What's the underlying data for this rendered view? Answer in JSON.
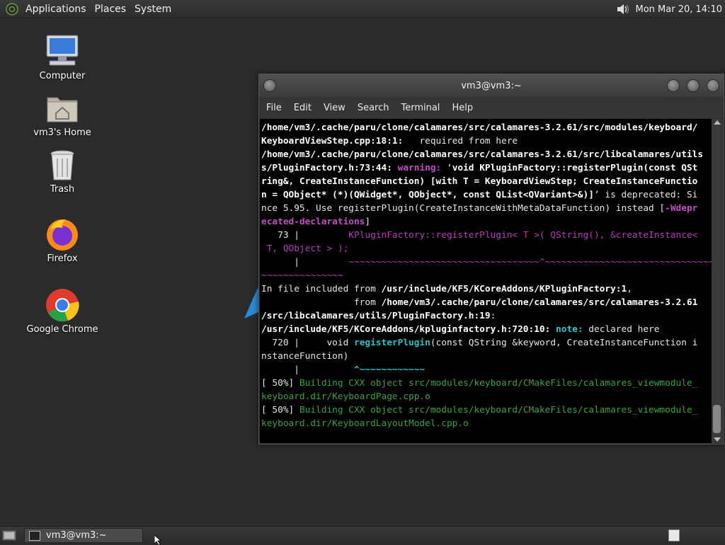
{
  "top_panel": {
    "menus": [
      "Applications",
      "Places",
      "System"
    ],
    "clock": "Mon Mar 20, 14:10"
  },
  "desktop_icons": [
    "Computer",
    "vm3's Home",
    "Trash",
    "Firefox",
    "Google Chrome"
  ],
  "window": {
    "title": "vm3@vm3:~",
    "menus": [
      "File",
      "Edit",
      "View",
      "Search",
      "Terminal",
      "Help"
    ]
  },
  "terminal": {
    "lines": [
      [
        {
          "t": "/home/vm3/.cache/paru/clone/calamares/src/calamares-3.2.61/src/modules/keyboard/",
          "c": "b"
        }
      ],
      [
        {
          "t": "KeyboardViewStep.cpp:18:1:",
          "c": "b"
        },
        {
          "t": "   required from here",
          "c": "wt"
        }
      ],
      [
        {
          "t": "/home/vm3/.cache/paru/clone/calamares/src/calamares-3.2.61/src/libcalamares/utils",
          "c": "b"
        }
      ],
      [
        {
          "t": "s/PluginFactory.h:73:44: ",
          "c": "b"
        },
        {
          "t": "warning: ",
          "c": "warn"
        },
        {
          "t": "‘",
          "c": "wt"
        },
        {
          "t": "void KPluginFactory::registerPlugin(const QSt",
          "c": "b"
        }
      ],
      [
        {
          "t": "ring&, CreateInstanceFunction) [with T = KeyboardViewStep; CreateInstanceFunctio",
          "c": "b"
        }
      ],
      [
        {
          "t": "n = QObject* (*)(QWidget*, QObject*, const QList<QVariant>&)]",
          "c": "b"
        },
        {
          "t": "’ is deprecated: Si",
          "c": "wt"
        }
      ],
      [
        {
          "t": "nce 5.95. Use registerPlugin(CreateInstanceWithMetaDataFunction) instead [",
          "c": "wt"
        },
        {
          "t": "-Wdepr",
          "c": "warn"
        }
      ],
      [
        {
          "t": "ecated-declarations",
          "c": "warn"
        },
        {
          "t": "]",
          "c": "wt"
        }
      ],
      [
        {
          "t": "   73 |         ",
          "c": "wt"
        },
        {
          "t": "KPluginFactory::registerPlugin< T >( QString(), &createInstance<",
          "c": "mag"
        }
      ],
      [
        {
          "t": " T, QObject > );",
          "c": "mag"
        }
      ],
      [
        {
          "t": "      |         ",
          "c": "wt"
        },
        {
          "t": "~~~~~~~~~~~~~~~~~~~~~~~~~~~~~~~~~~~^~~~~~~~~~~~~~~~~~~~~~~~~~~~~~~~~~~~~",
          "c": "mag"
        }
      ],
      [
        {
          "t": "~~~~~~~~~~~~~~~",
          "c": "mag"
        }
      ],
      [
        {
          "t": "In file included from ",
          "c": "wt"
        },
        {
          "t": "/usr/include/KF5/KCoreAddons/KPluginFactory:1",
          "c": "b"
        },
        {
          "t": ",",
          "c": "wt"
        }
      ],
      [
        {
          "t": "                 from ",
          "c": "wt"
        },
        {
          "t": "/home/vm3/.cache/paru/clone/calamares/src/calamares-3.2.61",
          "c": "b"
        }
      ],
      [
        {
          "t": "/src/libcalamares/utils/PluginFactory.h:19",
          "c": "b"
        },
        {
          "t": ":",
          "c": "wt"
        }
      ],
      [
        {
          "t": "/usr/include/KF5/KCoreAddons/kpluginfactory.h:720:10: ",
          "c": "b"
        },
        {
          "t": "note: ",
          "c": "note"
        },
        {
          "t": "declared here",
          "c": "wt"
        }
      ],
      [
        {
          "t": "  720 |     void ",
          "c": "wt"
        },
        {
          "t": "registerPlugin",
          "c": "cy"
        },
        {
          "t": "(const QString &keyword, CreateInstanceFunction i",
          "c": "wt"
        }
      ],
      [
        {
          "t": "nstanceFunction)",
          "c": "wt"
        }
      ],
      [
        {
          "t": "      |          ",
          "c": "wt"
        },
        {
          "t": "^~~~~~~~~~~~~",
          "c": "cy"
        }
      ],
      [
        {
          "t": "[ 50%] ",
          "c": "wt"
        },
        {
          "t": "Building CXX object src/modules/keyboard/CMakeFiles/calamares_viewmodule_",
          "c": "gn"
        }
      ],
      [
        {
          "t": "keyboard.dir/KeyboardPage.cpp.o",
          "c": "gn"
        }
      ],
      [
        {
          "t": "[ 50%] ",
          "c": "wt"
        },
        {
          "t": "Building CXX object src/modules/keyboard/CMakeFiles/calamares_viewmodule_",
          "c": "gn"
        }
      ],
      [
        {
          "t": "keyboard.dir/KeyboardLayoutModel.cpp.o",
          "c": "gn"
        }
      ]
    ]
  },
  "taskbar": {
    "task_label": "vm3@vm3:~"
  }
}
